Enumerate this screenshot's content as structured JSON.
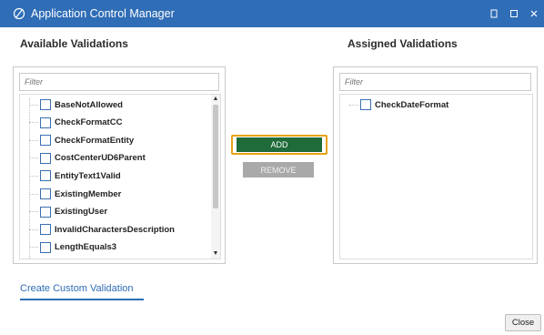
{
  "window": {
    "title": "Application Control Manager",
    "icon": "app-logo-icon",
    "controls": [
      "restore-icon",
      "maximize-icon",
      "close-icon"
    ]
  },
  "available": {
    "title": "Available Validations",
    "filter_placeholder": "Filter",
    "items": [
      {
        "label": "BaseNotAllowed",
        "checked": false
      },
      {
        "label": "CheckFormatCC",
        "checked": false
      },
      {
        "label": "CheckFormatEntity",
        "checked": false
      },
      {
        "label": "CostCenterUD6Parent",
        "checked": false
      },
      {
        "label": "EntityText1Valid",
        "checked": false
      },
      {
        "label": "ExistingMember",
        "checked": false
      },
      {
        "label": "ExistingUser",
        "checked": false
      },
      {
        "label": "InvalidCharactersDescription",
        "checked": false
      },
      {
        "label": "LengthEquals3",
        "checked": false
      }
    ]
  },
  "assigned": {
    "title": "Assigned Validations",
    "filter_placeholder": "Filter",
    "items": [
      {
        "label": "CheckDateFormat",
        "checked": false
      }
    ]
  },
  "actions": {
    "add_label": "ADD",
    "remove_label": "REMOVE"
  },
  "footer": {
    "custom_link": "Create Custom Validation",
    "close_label": "Close"
  },
  "colors": {
    "titlebar": "#2f6db6",
    "add_button": "#1f6b3a",
    "add_highlight": "#e8a317",
    "remove_button": "#a9a9a9",
    "link": "#2f6db6"
  }
}
